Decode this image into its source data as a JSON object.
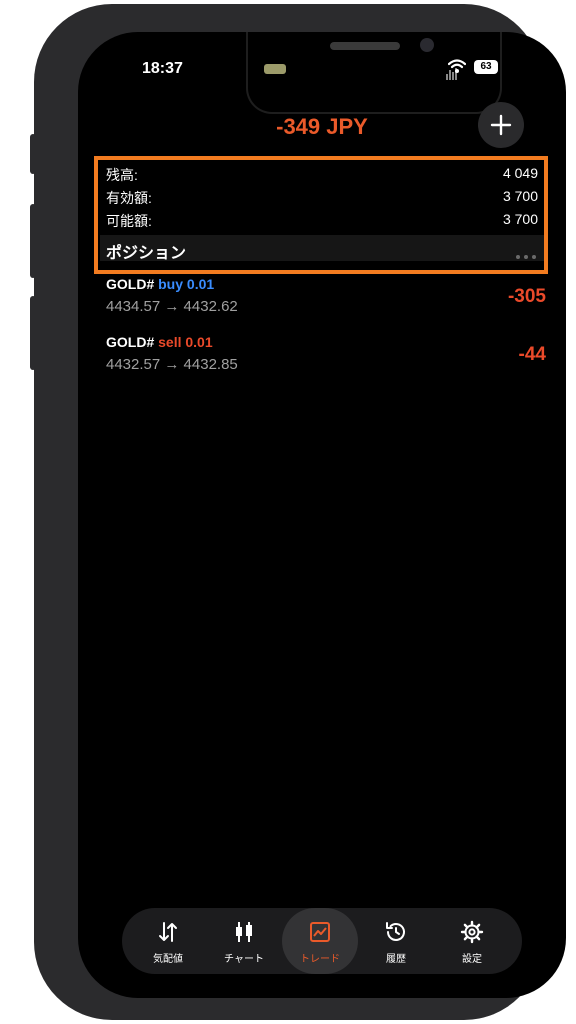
{
  "status_bar": {
    "time": "18:37",
    "battery": "63"
  },
  "header": {
    "amount": "-349 JPY"
  },
  "summary": {
    "rows": [
      {
        "label": "残高:",
        "value": "4 049"
      },
      {
        "label": "有効額:",
        "value": "3 700"
      },
      {
        "label": "可能額:",
        "value": "3 700"
      }
    ],
    "positions_title": "ポジション"
  },
  "positions": [
    {
      "symbol": "GOLD#",
      "side": "buy 0.01",
      "prices": "4434.57 → 4432.62",
      "profit": "-305"
    },
    {
      "symbol": "GOLD#",
      "side": "sell 0.01",
      "prices": "4432.57 → 4432.85",
      "profit": "-44"
    }
  ],
  "tabs": [
    {
      "label": "気配値",
      "icon": "quotes-arrows-icon"
    },
    {
      "label": "チャート",
      "icon": "candlestick-icon"
    },
    {
      "label": "トレード",
      "icon": "trade-chart-icon"
    },
    {
      "label": "履歴",
      "icon": "history-icon"
    },
    {
      "label": "設定",
      "icon": "gear-icon"
    }
  ],
  "colors": {
    "accent": "#ea5a2a",
    "highlight": "#f37c20",
    "buy": "#3a8dff",
    "sell": "#ea4a2a"
  }
}
